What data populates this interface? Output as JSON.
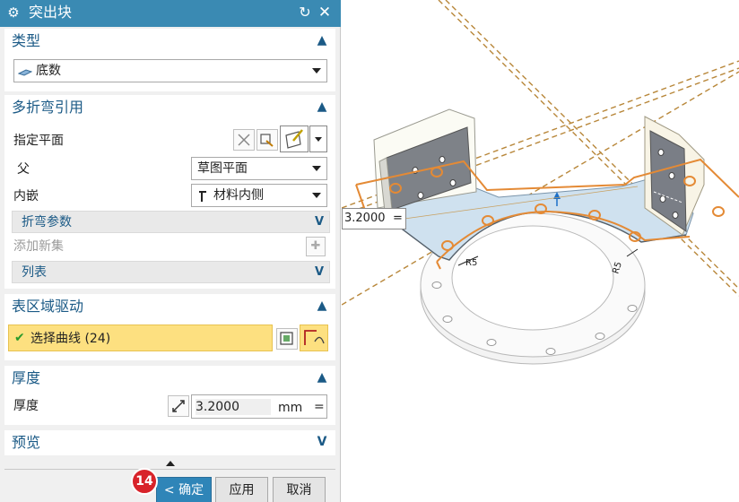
{
  "dialog": {
    "title": "突出块",
    "reset_symbol": "↻",
    "close_symbol": "✕"
  },
  "type_section": {
    "title": "类型",
    "selected": "底数"
  },
  "multibend_section": {
    "title": "多折弯引用",
    "specify_plane_label": "指定平面",
    "parent_label": "父",
    "parent_value": "草图平面",
    "inset_label": "内嵌",
    "inset_value": "材料内侧",
    "bend_params_label": "折弯参数",
    "add_new_label": "添加新集",
    "list_label": "列表"
  },
  "surface_section": {
    "title": "表区域驱动",
    "selected_curve": "选择曲线 (24)"
  },
  "thickness_section": {
    "title": "厚度",
    "label": "厚度",
    "value": "3.2000",
    "unit": "mm",
    "eq": "="
  },
  "preview_section": {
    "title": "预览"
  },
  "footer": {
    "step_badge": "14",
    "ok_label": "< 确定 >",
    "apply_label": "应用",
    "cancel_label": "取消"
  },
  "viewport": {
    "thickness_input_value": "3.2000",
    "thickness_input_eq": "=",
    "radius_label_left": "R5",
    "radius_label_right": "R5"
  }
}
